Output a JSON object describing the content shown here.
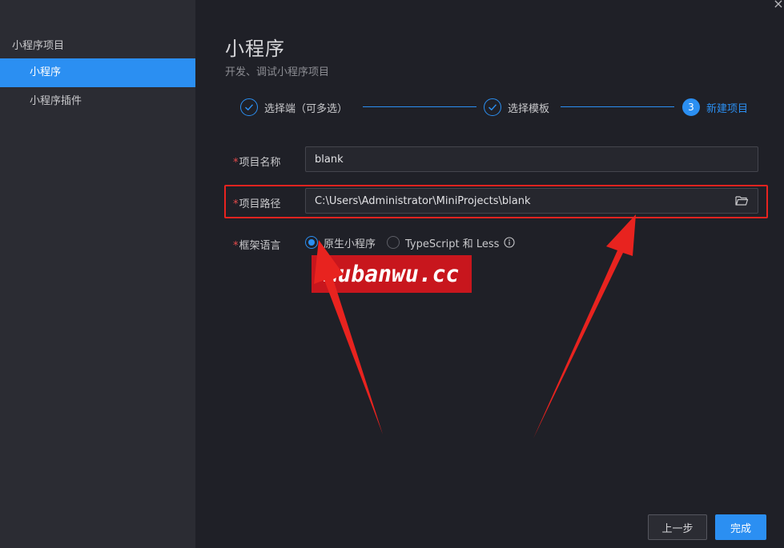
{
  "window": {
    "close_glyph": "×"
  },
  "sidebar": {
    "heading": "小程序项目",
    "items": [
      {
        "label": "小程序",
        "active": true
      },
      {
        "label": "小程序插件",
        "active": false
      }
    ]
  },
  "header": {
    "title": "小程序",
    "subtitle": "开发、调试小程序项目"
  },
  "steps": [
    {
      "label": "选择端（可多选）",
      "state": "done"
    },
    {
      "label": "选择模板",
      "state": "done"
    },
    {
      "label": "新建项目",
      "state": "current",
      "number": "3"
    }
  ],
  "form": {
    "required_mark": "*",
    "name": {
      "label": "项目名称",
      "value": "blank"
    },
    "path": {
      "label": "项目路径",
      "value": "C:\\Users\\Administrator\\MiniProjects\\blank"
    },
    "framework": {
      "label": "框架语言",
      "options": [
        {
          "label": "原生小程序",
          "checked": true
        },
        {
          "label": "TypeScript 和 Less",
          "checked": false
        }
      ]
    }
  },
  "watermark": {
    "text": "mubanwu.cc"
  },
  "footer": {
    "prev_label": "上一步",
    "done_label": "完成"
  },
  "colors": {
    "accent": "#2b8ff2",
    "highlight": "#e8231f",
    "watermark_bg": "#c8161d"
  }
}
